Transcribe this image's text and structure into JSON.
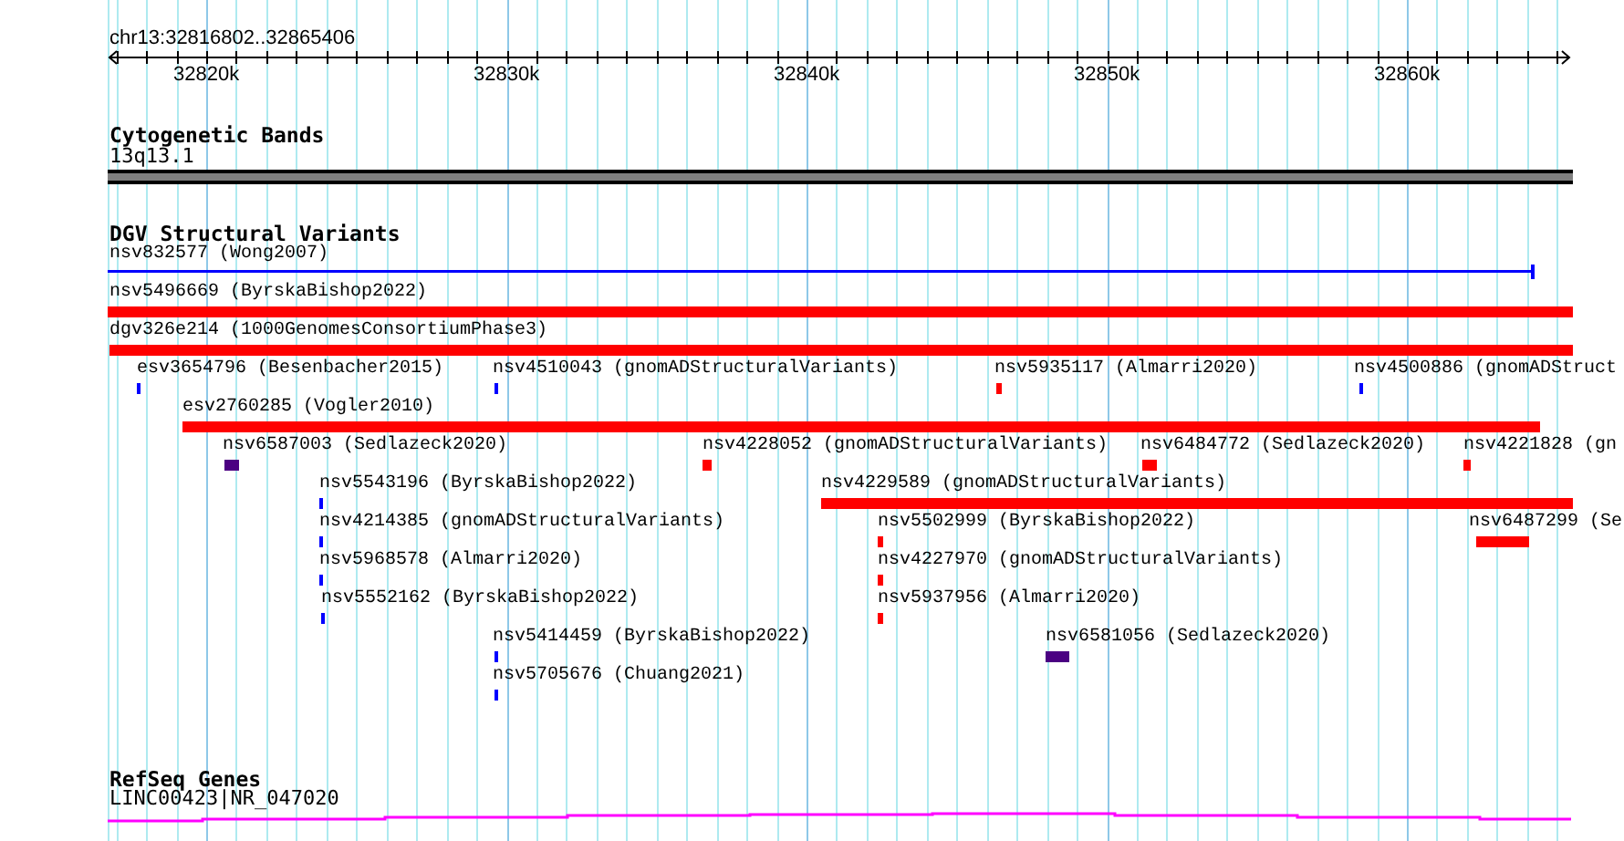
{
  "ruler": {
    "location": "chr13:32816802..32865406",
    "ticks": [
      "32820k",
      "32830k",
      "32840k",
      "32850k",
      "32860k"
    ]
  },
  "tracks": [
    {
      "title": "Cytogenetic Bands",
      "kind": "bands",
      "features": [
        {
          "label": "13q13.1"
        }
      ]
    },
    {
      "title": "DGV Structural Variants",
      "kind": "variants",
      "features": [
        {
          "label": "nsv832577 (Wong2007)",
          "kind": "line",
          "color": "#0000ff"
        },
        {
          "label": "nsv5496669 (ByrskaBishop2022)",
          "kind": "block",
          "color": "#ff0000"
        },
        {
          "label": "dgv326e214 (1000GenomesConsortiumPhase3)",
          "kind": "block",
          "color": "#ff0000"
        },
        {
          "label": "esv3654796 (Besenbacher2015)",
          "kind": "block",
          "color": "#0000ff"
        },
        {
          "label": "nsv4510043 (gnomADStructuralVariants)",
          "kind": "block",
          "color": "#0000ff"
        },
        {
          "label": "nsv5935117 (Almarri2020)",
          "kind": "block",
          "color": "#ff0000"
        },
        {
          "label": "nsv4500886 (gnomADStruct",
          "kind": "block",
          "color": "#0000ff"
        },
        {
          "label": "esv2760285 (Vogler2010)",
          "kind": "block",
          "color": "#ff0000"
        },
        {
          "label": "nsv6587003 (Sedlazeck2020)",
          "kind": "block",
          "color": "#4b0082"
        },
        {
          "label": "nsv4228052 (gnomADStructuralVariants)",
          "kind": "block",
          "color": "#ff0000"
        },
        {
          "label": "nsv6484772 (Sedlazeck2020)",
          "kind": "block",
          "color": "#ff0000"
        },
        {
          "label": "nsv4221828 (gn",
          "kind": "block",
          "color": "#ff0000"
        },
        {
          "label": "nsv5543196 (ByrskaBishop2022)",
          "kind": "block",
          "color": "#0000ff"
        },
        {
          "label": "nsv4229589 (gnomADStructuralVariants)",
          "kind": "block",
          "color": "#ff0000"
        },
        {
          "label": "nsv4214385 (gnomADStructuralVariants)",
          "kind": "block",
          "color": "#0000ff"
        },
        {
          "label": "nsv5502999 (ByrskaBishop2022)",
          "kind": "block",
          "color": "#ff0000"
        },
        {
          "label": "nsv6487299 (Se",
          "kind": "block",
          "color": "#ff0000"
        },
        {
          "label": "nsv5968578 (Almarri2020)",
          "kind": "block",
          "color": "#0000ff"
        },
        {
          "label": "nsv4227970 (gnomADStructuralVariants)",
          "kind": "block",
          "color": "#ff0000"
        },
        {
          "label": "nsv5552162 (ByrskaBishop2022)",
          "kind": "block",
          "color": "#0000ff"
        },
        {
          "label": "nsv5937956 (Almarri2020)",
          "kind": "block",
          "color": "#ff0000"
        },
        {
          "label": "nsv5414459 (ByrskaBishop2022)",
          "kind": "block",
          "color": "#0000ff"
        },
        {
          "label": "nsv6581056 (Sedlazeck2020)",
          "kind": "block",
          "color": "#4b0082"
        },
        {
          "label": "nsv5705676 (Chuang2021)",
          "kind": "block",
          "color": "#0000ff"
        }
      ]
    },
    {
      "title": "RefSeq Genes",
      "kind": "genes",
      "features": [
        {
          "label": "LINC00423|NR_047020"
        }
      ]
    }
  ]
}
